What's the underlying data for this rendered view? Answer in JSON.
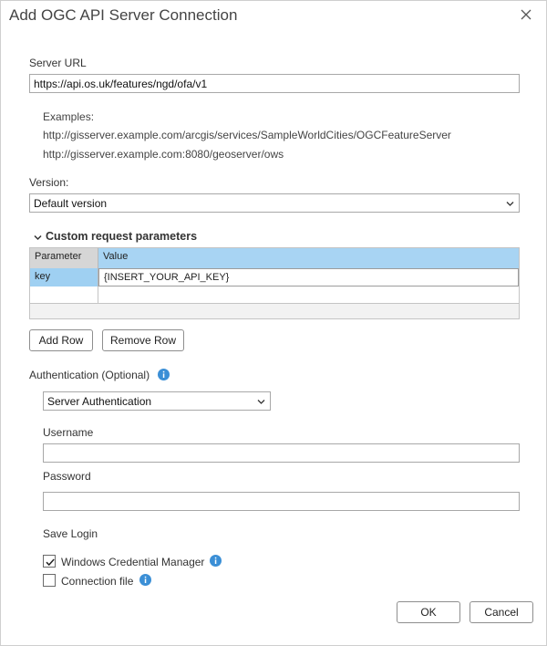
{
  "dialog": {
    "title": "Add OGC API Server Connection",
    "close_icon": "close-icon"
  },
  "server_url": {
    "label": "Server URL",
    "value": "https://api.os.uk/features/ngd/ofa/v1",
    "examples_label": "Examples:",
    "example_1": "http://gisserver.example.com/arcgis/services/SampleWorldCities/OGCFeatureServer",
    "example_2": "http://gisserver.example.com:8080/geoserver/ows"
  },
  "version": {
    "label": "Version:",
    "selected": "Default version",
    "icon": "chevron-down-icon"
  },
  "custom_params": {
    "header": "Custom request parameters",
    "columns": [
      "Parameter",
      "Value"
    ],
    "rows": [
      {
        "parameter": "key",
        "value": "{INSERT_YOUR_API_KEY}"
      },
      {
        "parameter": "",
        "value": ""
      }
    ],
    "add_row": "Add Row",
    "remove_row": "Remove Row"
  },
  "authentication": {
    "label": "Authentication (Optional)",
    "selected": "Server Authentication",
    "username_label": "Username",
    "username_value": "",
    "password_label": "Password",
    "password_value": "",
    "save_login_label": "Save Login",
    "windows_credential_manager": "Windows Credential Manager",
    "windows_credential_checked": true,
    "connection_file": "Connection file",
    "connection_file_checked": false
  },
  "footer": {
    "ok": "OK",
    "cancel": "Cancel"
  },
  "colors": {
    "accent": "#3b8fd6",
    "grid_header": "#a8d4f3",
    "grid_selected": "#9fd0f2"
  }
}
